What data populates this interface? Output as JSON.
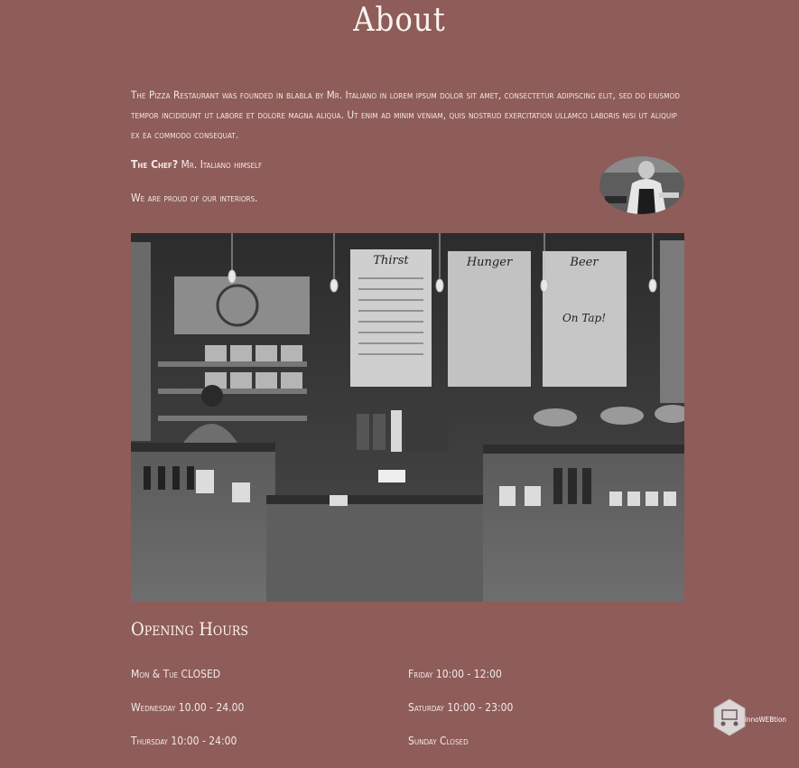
{
  "page": {
    "title": "About"
  },
  "about": {
    "intro": "The Pizza Restaurant was founded in blabla by Mr. Italiano in lorem ipsum dolor sit amet, consectetur adipiscing elit, sed do eiusmod tempor incididunt ut labore et dolore magna aliqua. Ut enim ad minim veniam, quis nostrud exercitation ullamco laboris nisi ut aliquip ex ea commodo consequat.",
    "chef_label": "The Chef?",
    "chef_value": "Mr. Italiano himself",
    "interiors_text": "We are proud of our interiors.",
    "menu_boards": [
      "Thirst",
      "Hunger",
      "Beer"
    ],
    "on_tap": "On Tap!"
  },
  "hours": {
    "title": "Opening Hours",
    "left": [
      "Mon & Tue CLOSED",
      "Wednesday 10.00 - 24.00",
      "Thursday 10:00 - 24:00"
    ],
    "right": [
      "Friday 10:00 - 12:00",
      "Saturday 10:00 - 23:00",
      "Sunday Closed"
    ]
  },
  "badge": {
    "label": "innoWEBtion"
  },
  "colors": {
    "background": "#8e5c59",
    "text": "#f3e9e6"
  }
}
